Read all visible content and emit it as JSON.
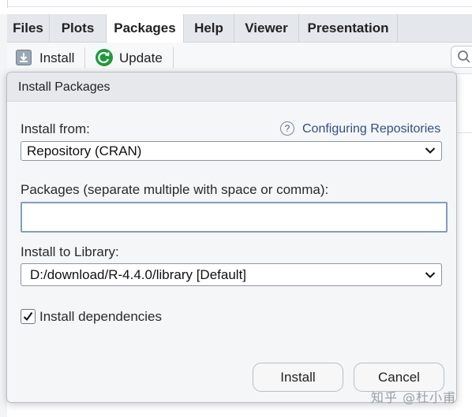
{
  "tabs": [
    {
      "label": "Files"
    },
    {
      "label": "Plots"
    },
    {
      "label": "Packages",
      "active": true
    },
    {
      "label": "Help"
    },
    {
      "label": "Viewer"
    },
    {
      "label": "Presentation"
    }
  ],
  "toolbar": {
    "install_label": "Install",
    "update_label": "Update",
    "install_icon": "install-package-icon",
    "update_icon": "refresh-icon",
    "search_icon": "search-icon"
  },
  "dialog": {
    "title": "Install Packages",
    "install_from_label": "Install from:",
    "help_link": "Configuring Repositories",
    "help_icon": "question-icon",
    "install_from_value": "Repository (CRAN)",
    "packages_label": "Packages (separate multiple with space or comma):",
    "packages_value": "",
    "library_label": "Install to Library:",
    "library_value": "D:/download/R-4.4.0/library [Default]",
    "dependencies_label": "Install dependencies",
    "dependencies_checked": true,
    "install_button": "Install",
    "cancel_button": "Cancel"
  },
  "watermark": "知乎 @杜小甫",
  "colors": {
    "link": "#2f4f8a",
    "update_icon": "#1d9a3a",
    "input_focus_border": "#7f9ec4"
  }
}
